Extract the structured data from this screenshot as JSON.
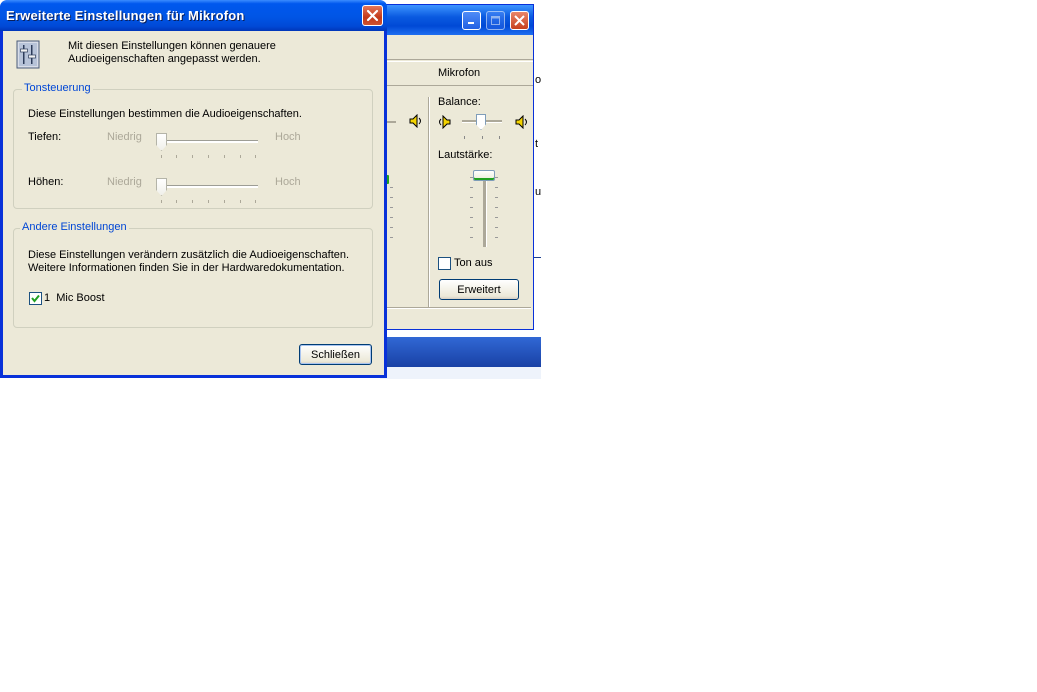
{
  "background_window": {
    "column_header": "Mikrofon",
    "balance_label": "Balance:",
    "volume_label": "Lautstärke:",
    "mute_label": "Ton aus",
    "mute_checked": false,
    "advanced_button": "Erweitert",
    "minimize_icon": "minimize-icon",
    "maximize_icon": "maximize-icon",
    "close_icon": "close-icon",
    "volume_level_percent": 100,
    "balance_level_percent": 50,
    "edge_letters": [
      "o",
      "t",
      "u"
    ]
  },
  "dialog": {
    "title": "Erweiterte Einstellungen für Mikrofon",
    "header_text": "Mit diesen Einstellungen können genauere Audioeigenschaften angepasst werden.",
    "tone_group": {
      "title": "Tonsteuerung",
      "description": "Diese Einstellungen bestimmen die Audioeigenschaften.",
      "bass_label": "Tiefen:",
      "treble_label": "Höhen:",
      "low_label": "Niedrig",
      "high_label": "Hoch",
      "bass_level_percent": 0,
      "treble_level_percent": 0,
      "disabled": true
    },
    "other_group": {
      "title": "Andere Einstellungen",
      "description_line1": "Diese Einstellungen verändern zusätzlich die Audioeigenschaften.",
      "description_line2": "Weitere Informationen finden Sie in der Hardwaredokumentation.",
      "checkbox_label": "1  Mic Boost",
      "checkbox_checked": true
    },
    "close_button": "Schließen"
  },
  "colors": {
    "title_bar": "#0055e5",
    "dialog_face": "#ece9d8",
    "group_title": "#0046d5",
    "check_mark": "#21a121"
  }
}
